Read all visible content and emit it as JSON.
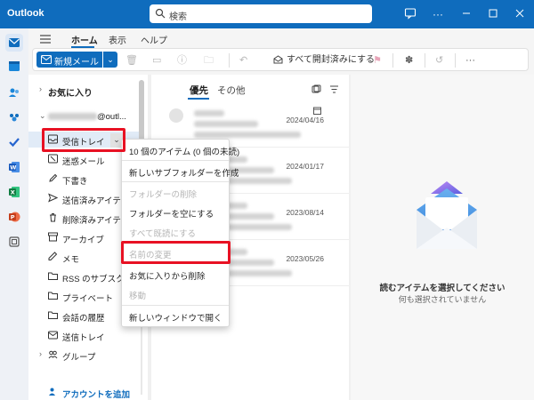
{
  "titlebar": {
    "app_title": "Outlook",
    "search_placeholder": "検索"
  },
  "ribbon": {
    "tabs": [
      "ホーム",
      "表示",
      "ヘルプ"
    ],
    "new_mail_label": "新規メール",
    "mark_all_read_label": "すべて開封済みにする",
    "more_label": "···"
  },
  "folders": {
    "favorites_label": "お気に入り",
    "account_suffix": "@outl...",
    "inbox": "受信トレイ",
    "items": [
      "迷惑メール",
      "下書き",
      "送信済みアイテム",
      "削除済みアイテム",
      "アーカイブ",
      "メモ",
      "RSS のサブスクリプ",
      "プライベート",
      "会話の履歴",
      "送信トレイ"
    ],
    "group_label": "グループ",
    "add_account_label": "アカウントを追加"
  },
  "message_list": {
    "tabs": [
      "優先",
      "その他"
    ],
    "dates": [
      "2024/04/16",
      "2024/01/17",
      "2023/08/14",
      "2023/05/26"
    ]
  },
  "context_menu": {
    "header": "10 個のアイテム (0 個の未読)",
    "items": [
      {
        "label": "新しいサブフォルダーを作成",
        "enabled": true
      },
      {
        "label": "フォルダーの削除",
        "enabled": false
      },
      {
        "label": "フォルダーを空にする",
        "enabled": true
      },
      {
        "label": "すべて既読にする",
        "enabled": false
      },
      {
        "label": "名前の変更",
        "enabled": false
      },
      {
        "label": "お気に入りから削除",
        "enabled": true
      },
      {
        "label": "移動",
        "enabled": false
      },
      {
        "label": "新しいウィンドウで開く",
        "enabled": true
      }
    ]
  },
  "reading_pane": {
    "title": "読むアイテムを選択してください",
    "subtitle": "何も選択されていません"
  },
  "colors": {
    "brand": "#0f6cbd",
    "highlight": "#e81123"
  }
}
